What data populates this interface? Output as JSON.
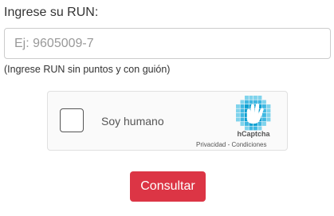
{
  "form": {
    "run_label": "Ingrese su RUN:",
    "run_placeholder": "Ej: 9605009-7",
    "run_value": "",
    "run_hint": "(Ingrese RUN sin puntos y con guión)"
  },
  "captcha": {
    "checkbox_label": "Soy humano",
    "brand": "hCaptcha",
    "privacy_link": "Privacidad",
    "separator": " - ",
    "terms_link": "Condiciones",
    "logo_icon": "hcaptcha-hand-icon",
    "logo_colors": {
      "light": "#7fd3ec",
      "mid": "#3fb8e2",
      "dark": "#0a9fd1"
    },
    "checked": false
  },
  "actions": {
    "submit_label": "Consultar",
    "submit_color": "#dc3545"
  }
}
